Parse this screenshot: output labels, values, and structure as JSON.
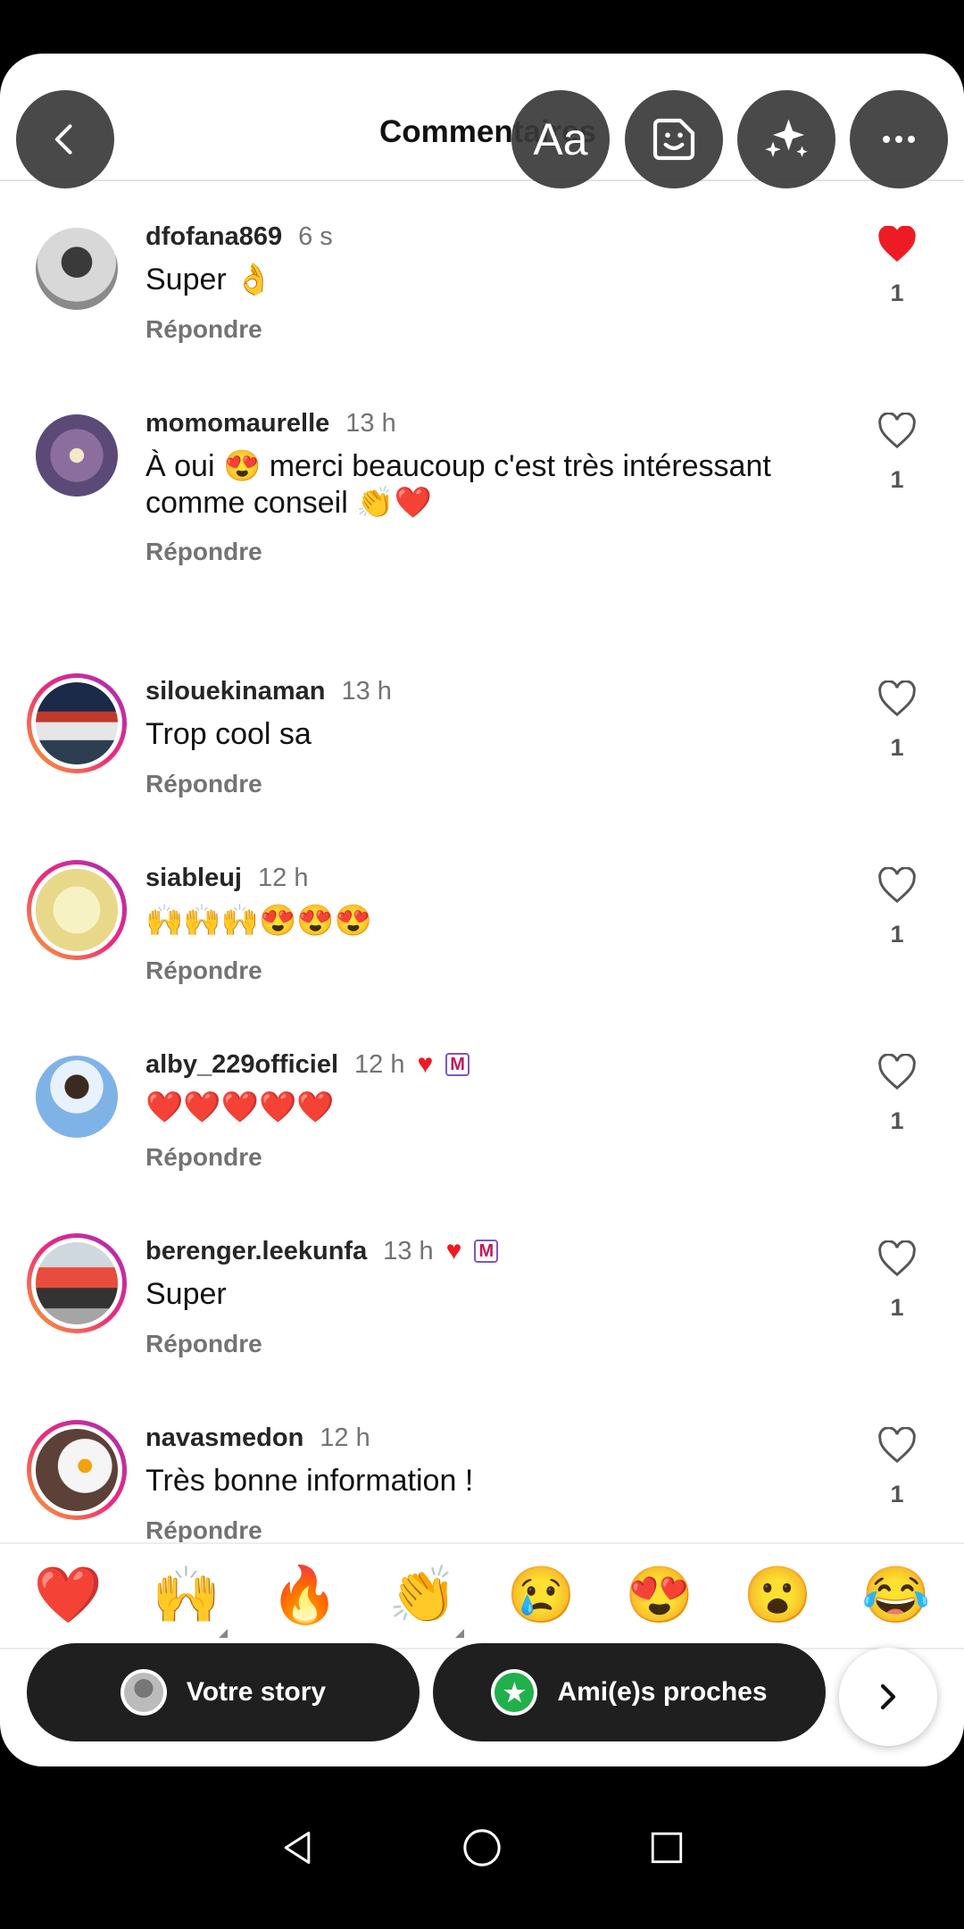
{
  "header": {
    "title": "Commentaires",
    "text_tool_label": "Aa"
  },
  "comments": [
    {
      "username": "dfofana869",
      "time": "6 s",
      "text": "Super 👌",
      "reply": "Répondre",
      "likes": "1",
      "liked": true
    },
    {
      "username": "momomaurelle",
      "time": "13 h",
      "text": "À oui 😍 merci beaucoup c'est très intéressant comme conseil 👏❤️",
      "reply": "Répondre",
      "likes": "1",
      "liked": false
    },
    {
      "username": "silouekinaman",
      "time": "13 h",
      "text": "Trop cool sa",
      "reply": "Répondre",
      "likes": "1",
      "liked": false
    },
    {
      "username": "siableuj",
      "time": "12 h",
      "text": "🙌🙌🙌😍😍😍",
      "reply": "Répondre",
      "likes": "1",
      "liked": false
    },
    {
      "username": "alby_229officiel",
      "time": "12 h",
      "text": "❤️❤️❤️❤️❤️",
      "reply": "Répondre",
      "likes": "1",
      "liked": false,
      "creator_liked": true,
      "badge": "M"
    },
    {
      "username": "berenger.leekunfa",
      "time": "13 h",
      "text": "Super",
      "reply": "Répondre",
      "likes": "1",
      "liked": false,
      "creator_liked": true,
      "badge": "M"
    },
    {
      "username": "navasmedon",
      "time": "12 h",
      "text": "Très bonne information !",
      "reply": "Répondre",
      "likes": "1",
      "liked": false
    }
  ],
  "emoji_bar": [
    "❤️",
    "🙌",
    "🔥",
    "👏",
    "😢",
    "😍",
    "😮",
    "😂"
  ],
  "share": {
    "your_story": "Votre story",
    "close_friends": "Ami(e)s proches"
  },
  "colors": {
    "liked_heart": "#ed1c24",
    "close_friends_green": "#21b04b",
    "pill_bg": "#1f1f1f"
  },
  "icons": [
    "back-arrow-icon",
    "sticker-icon",
    "sparkles-icon",
    "more-icon",
    "heart-icon",
    "chevron-right-icon",
    "nav-back-icon",
    "nav-home-icon",
    "nav-recents-icon"
  ]
}
